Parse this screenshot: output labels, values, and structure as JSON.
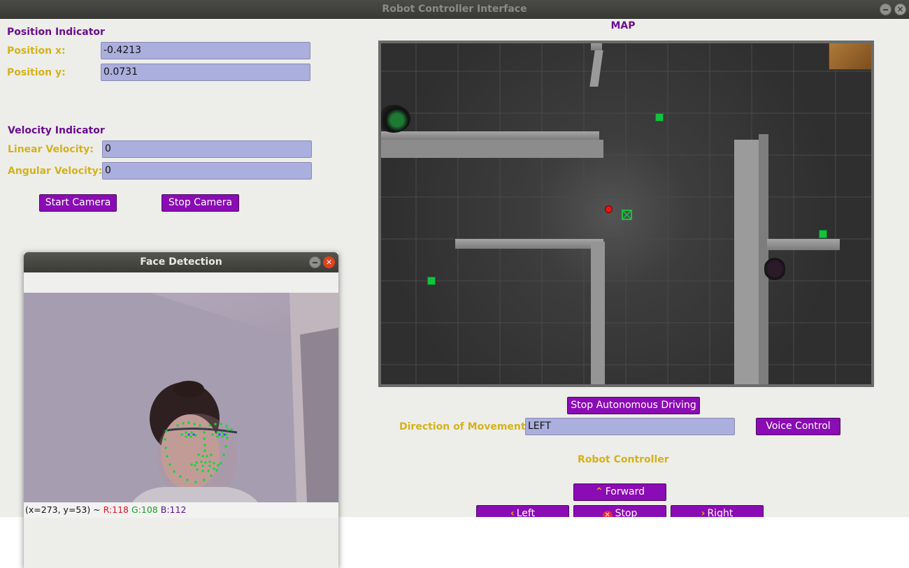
{
  "window": {
    "title": "Robot Controller Interface",
    "minimize_glyph": "",
    "close_glyph": "×"
  },
  "position": {
    "section_title": "Position Indicator",
    "x_label": "Position x:",
    "x_value": "-0.4213",
    "y_label": "Position y:",
    "y_value": "0.0731"
  },
  "velocity": {
    "section_title": "Velocity Indicator",
    "linear_label": "Linear Velocity:",
    "linear_value": "0",
    "angular_label": "Angular Velocity:",
    "angular_value": "0"
  },
  "camera_buttons": {
    "start": "Start Camera",
    "stop": "Stop Camera"
  },
  "map": {
    "title": "MAP"
  },
  "autonomous": {
    "stop_button": "Stop Autonomous Driving"
  },
  "direction": {
    "label": "Direction of Movement",
    "value": "LEFT"
  },
  "voice_button": "Voice Control",
  "controller": {
    "title": "Robot Controller",
    "forward": "Forward",
    "left": "Left",
    "stop": "Stop",
    "right": "Right",
    "forward_icon": "chevron-up-icon",
    "left_icon": "chevron-left-icon",
    "right_icon": "chevron-right-icon",
    "stop_icon": "stop-circle-icon"
  },
  "face_window": {
    "title": "Face Detection",
    "status_coords": "(x=273, y=53) ~",
    "status_r": "R:118",
    "status_g": "G:108",
    "status_b": "B:112"
  },
  "colors": {
    "accent_purple": "#8a0cb4",
    "label_gold": "#d4b11c",
    "heading_purple": "#6b0d8e",
    "field_fill": "#abafdd",
    "status_r": "#e8102a",
    "status_g": "#1a9b2c",
    "status_b": "#5a0f9a"
  }
}
